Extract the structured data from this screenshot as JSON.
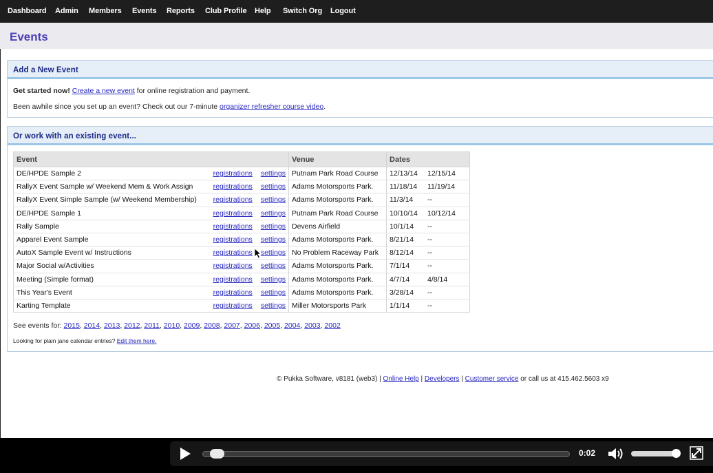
{
  "nav": [
    "Dashboard",
    "Admin",
    "Members",
    "Events",
    "Reports",
    "Club Profile",
    "Help",
    "Switch Org",
    "Logout"
  ],
  "page_title": "Events",
  "add_panel": {
    "title": "Add a New Event",
    "line1_bold": "Get started now!",
    "line1_link": "Create a new event",
    "line1_rest": " for online registration and payment.",
    "line2_text": "Been awhile since you set up an event? Check out our 7-minute ",
    "line2_link": "organizer refresher course video",
    "line2_end": "."
  },
  "existing_panel": {
    "title": "Or work with an existing event...",
    "columns": [
      "Event",
      "Venue",
      "Dates"
    ],
    "registrations_label": "registrations",
    "settings_label": "settings",
    "rows": [
      {
        "event": "DE/HPDE Sample 2",
        "venue": "Putnam Park Road Course",
        "start": "12/13/14",
        "end": "12/15/14"
      },
      {
        "event": "RallyX Event Sample w/ Weekend Mem & Work Assign",
        "venue": "Adams Motorsports Park.",
        "start": "11/18/14",
        "end": "11/19/14"
      },
      {
        "event": "RallyX Event Simple Sample (w/ Weekend Membership)",
        "venue": "Adams Motorsports Park.",
        "start": "11/3/14",
        "end": "--"
      },
      {
        "event": "DE/HPDE Sample 1",
        "venue": "Putnam Park Road Course",
        "start": "10/10/14",
        "end": "10/12/14"
      },
      {
        "event": "Rally Sample",
        "venue": "Devens Airfield",
        "start": "10/1/14",
        "end": "--"
      },
      {
        "event": "Apparel Event Sample",
        "venue": "Adams Motorsports Park.",
        "start": "8/21/14",
        "end": "--"
      },
      {
        "event": "AutoX Sample Event w/ Instructions",
        "venue": "No Problem Raceway Park",
        "start": "8/12/14",
        "end": "--"
      },
      {
        "event": "Major Social w/Activities",
        "venue": "Adams Motorsports Park.",
        "start": "7/1/14",
        "end": "--"
      },
      {
        "event": "Meeting (Simple format)",
        "venue": "Adams Motorsports Park.",
        "start": "4/7/14",
        "end": "4/8/14"
      },
      {
        "event": "This Year's Event",
        "venue": "Adams Motorsports Park.",
        "start": "3/28/14",
        "end": "--"
      },
      {
        "event": "Karting Template",
        "venue": "Miller Motorsports Park",
        "start": "1/1/14",
        "end": "--"
      }
    ],
    "see_events_label": "See events for:",
    "years": [
      "2015",
      "2014",
      "2013",
      "2012",
      "2011",
      "2010",
      "2009",
      "2008",
      "2007",
      "2006",
      "2005",
      "2004",
      "2003",
      "2002"
    ],
    "calendar_text": "Looking for plain jane calendar entries?",
    "calendar_link": "Edit them here."
  },
  "footer": {
    "prefix": "© Pukka Software, v8181 (web3) | ",
    "links": [
      "Online Help",
      "Developers",
      "Customer service"
    ],
    "suffix": " or call us at 415.462.5603 x9"
  },
  "video": {
    "time": "0:02",
    "progress": 0.04,
    "volume": 0.85,
    "icons": [
      "play-icon",
      "volume-icon",
      "fullscreen-icon"
    ]
  }
}
